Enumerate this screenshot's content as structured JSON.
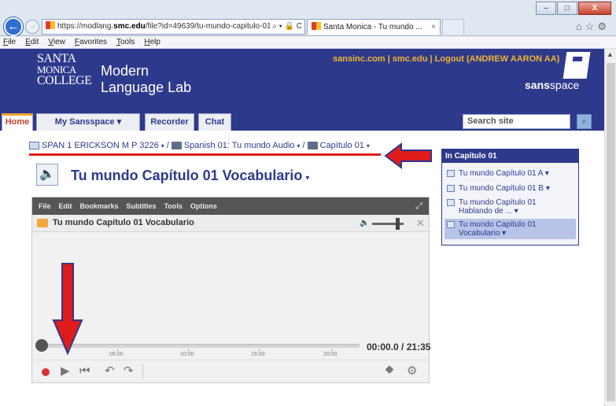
{
  "browser": {
    "url_prefix": "https://modlang.",
    "url_domain": "smc.edu",
    "url_suffix": "/file?id=49639/tu-mundo-capitulo-01-\\",
    "addr_icons": "⌕ ▾ 🔒 C",
    "tab_title": "Santa Monica - Tu mundo ...",
    "tab_close": "×",
    "window_buttons": {
      "minimize": "–",
      "maximize": "□",
      "close": "X"
    },
    "menu": [
      "File",
      "Edit",
      "View",
      "Favorites",
      "Tools",
      "Help"
    ],
    "toolbar_icons": "⌂☆⚙"
  },
  "site": {
    "logo_lines": [
      "SANTA",
      "MONICA",
      "COLLEGE"
    ],
    "lab_title_line1": "Modern",
    "lab_title_line2": "Language Lab",
    "header_links": "sansinc.com | smc.edu | Logout (ANDREW AARON AA)",
    "brand_bold": "sans",
    "brand_rest": "space",
    "nav": [
      "Home",
      "My Sansspace ▾",
      "Recorder",
      "Chat"
    ],
    "search_placeholder": "Search site",
    "search_icon": "⌕"
  },
  "breadcrumb": {
    "course": "SPAN 1 ERICKSON M P 3226",
    "folder1": "Spanish 01: Tu mundo Audio",
    "folder2": "Capítulo 01",
    "sep": "/",
    "caret": "▾"
  },
  "page": {
    "title": "Tu mundo Capítulo 01 Vocabulario",
    "title_caret": "▾"
  },
  "player": {
    "menu": [
      "File",
      "Edit",
      "Bookmarks",
      "Subtitles",
      "Tools",
      "Options"
    ],
    "title": "Tu mundo Capítulo 01 Vocabulario",
    "time_current": "00:00.0",
    "time_total": "21:35",
    "time_sep": " / ",
    "ticks": [
      "05:00",
      "10:00",
      "15:00",
      "20:00"
    ],
    "progress": 0
  },
  "sidepanel": {
    "header": "In Capítulo 01",
    "items": [
      {
        "line1": "Tu mundo Capítulo 01 A",
        "line2": ""
      },
      {
        "line1": "Tu mundo Capítulo 01 B",
        "line2": ""
      },
      {
        "line1": "Tu mundo Capítulo 01",
        "line2": "Hablando de ..."
      },
      {
        "line1": "Tu mundo Capítulo 01",
        "line2": "Vocabulario"
      }
    ],
    "caret": "▾"
  },
  "colors": {
    "brand": "#2d3a8c",
    "accent_orange": "#f0b431",
    "annotation_red": "#e01b1b"
  }
}
